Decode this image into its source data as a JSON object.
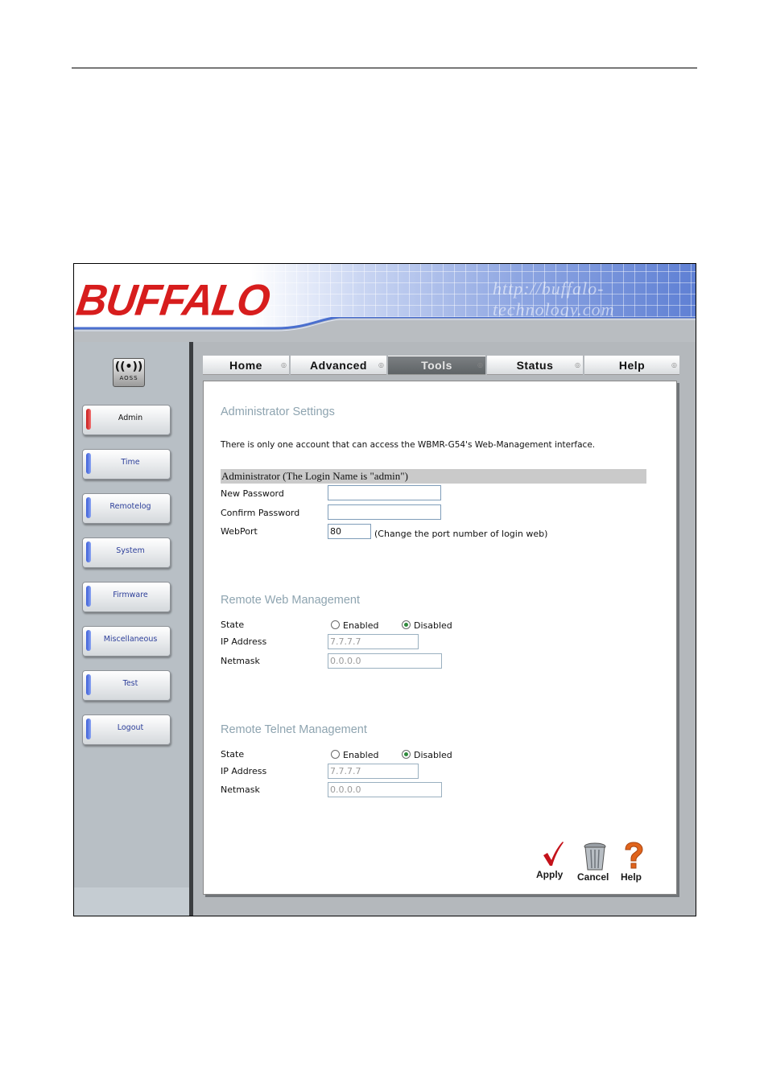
{
  "brand": {
    "logo_text": "BUFFALO",
    "header_watermark": "http://buffalo-technology.com"
  },
  "aoss": {
    "glyph": "((•))",
    "label": "AOSS"
  },
  "sidebar": {
    "items": [
      {
        "label": "Admin",
        "active": true
      },
      {
        "label": "Time"
      },
      {
        "label": "Remotelog"
      },
      {
        "label": "System"
      },
      {
        "label": "Firmware"
      },
      {
        "label": "Miscellaneous"
      },
      {
        "label": "Test"
      },
      {
        "label": "Logout"
      }
    ]
  },
  "tabs": [
    {
      "label": "Home"
    },
    {
      "label": "Advanced"
    },
    {
      "label": "Tools",
      "active": true
    },
    {
      "label": "Status"
    },
    {
      "label": "Help"
    }
  ],
  "admin": {
    "title": "Administrator Settings",
    "description": "There is only one account that can access the WBMR-G54's Web-Management interface.",
    "bar_label": "Administrator (The Login Name is \"admin\")",
    "new_password_label": "New Password",
    "new_password_value": "",
    "confirm_password_label": "Confirm Password",
    "confirm_password_value": "",
    "webport_label": "WebPort",
    "webport_value": "80",
    "webport_hint": "(Change the port number of login web)"
  },
  "remote_web": {
    "title": "Remote Web Management",
    "state_label": "State",
    "enabled_label": "Enabled",
    "disabled_label": "Disabled",
    "selected": "Disabled",
    "ip_label": "IP Address",
    "ip_value": "7.7.7.7",
    "netmask_label": "Netmask",
    "netmask_value": "0.0.0.0"
  },
  "remote_telnet": {
    "title": "Remote Telnet Management",
    "state_label": "State",
    "enabled_label": "Enabled",
    "disabled_label": "Disabled",
    "selected": "Disabled",
    "ip_label": "IP Address",
    "ip_value": "7.7.7.7",
    "netmask_label": "Netmask",
    "netmask_value": "0.0.0.0"
  },
  "actions": {
    "apply": "Apply",
    "cancel": "Cancel",
    "help": "Help"
  },
  "icons": {
    "apply": "checkmark-icon",
    "cancel": "trash-can-icon",
    "help": "question-mark-icon"
  },
  "colors": {
    "logo": "#d71d1d",
    "section_title": "#8ea4b0",
    "active_tab": "#5e6366",
    "sidebar_link": "#2d3f9a"
  }
}
